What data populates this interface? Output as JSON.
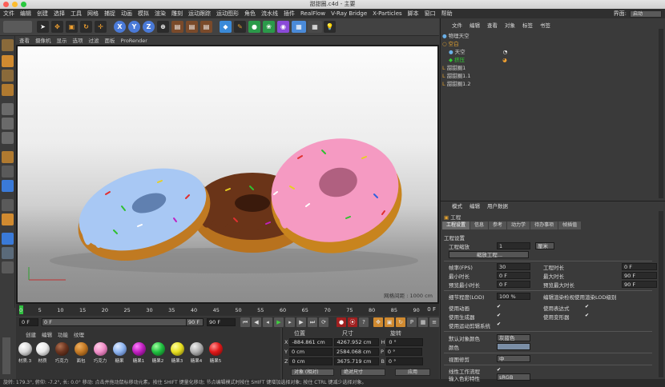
{
  "window": {
    "title": "甜甜圈.c4d - 主要"
  },
  "menubar": {
    "items": [
      "文件",
      "编辑",
      "创建",
      "选择",
      "工具",
      "网格",
      "捕捉",
      "动画",
      "模拟",
      "渲染",
      "雕刻",
      "运动跟踪",
      "运动图形",
      "角色",
      "流水线",
      "插件",
      "RealFlow",
      "V-Ray Bridge",
      "X-Particles",
      "脚本",
      "窗口",
      "帮助"
    ],
    "layout_label": "界面:",
    "layout_value": "启动"
  },
  "toolbar": {
    "axis_x": "X",
    "axis_y": "Y",
    "axis_z": "Z"
  },
  "viewport": {
    "menu": [
      "查看",
      "摄像机",
      "显示",
      "选项",
      "过滤",
      "面板",
      "ProRender"
    ],
    "grid_label": "网格间距 : 1000 cm"
  },
  "timeline": {
    "ticks": [
      "0",
      "5",
      "10",
      "15",
      "20",
      "25",
      "30",
      "35",
      "40",
      "45",
      "50",
      "55",
      "60",
      "65",
      "70",
      "75",
      "80",
      "85",
      "90"
    ],
    "frame_end_label": "0 F",
    "current_frame": "0 F",
    "start_frame": "0 F",
    "end_frame": "90 F",
    "max_frame": "90 F"
  },
  "materials": {
    "menu": [
      "创建",
      "编辑",
      "功能",
      "纹理"
    ],
    "items": [
      {
        "label": "材质.3",
        "color": "#d8d8d8"
      },
      {
        "label": "材质",
        "color": "#e9e9e9"
      },
      {
        "label": "巧克力",
        "color": "#6b3520"
      },
      {
        "label": "面包",
        "color": "#c47a25"
      },
      {
        "label": "巧克力",
        "color": "#f08fc8"
      },
      {
        "label": "糖果",
        "color": "#8fb5f0"
      },
      {
        "label": "糖果1",
        "color": "#c020c0"
      },
      {
        "label": "糖果2",
        "color": "#20c040"
      },
      {
        "label": "糖果3",
        "color": "#e8e020"
      },
      {
        "label": "糖果4",
        "color": "#b0b0b0"
      },
      {
        "label": "糖果5",
        "color": "#e01818"
      }
    ]
  },
  "coords": {
    "headers": [
      "位置",
      "尺寸",
      "旋转"
    ],
    "rows": [
      {
        "axis": "X",
        "pos": "-884.861 cm",
        "size": "4267.952 cm",
        "rot_axis": "H",
        "rot": "0 °"
      },
      {
        "axis": "Y",
        "pos": "0 cm",
        "size": "2584.068 cm",
        "rot_axis": "P",
        "rot": "0 °"
      },
      {
        "axis": "Z",
        "pos": "0 cm",
        "size": "3675.719 cm",
        "rot_axis": "B",
        "rot": "0 °"
      }
    ],
    "mode": "对象 (相对)",
    "size_mode": "绝对尺寸",
    "apply": "应用"
  },
  "objects": {
    "menu": [
      "文件",
      "编辑",
      "查看",
      "对象",
      "标签",
      "书签"
    ],
    "items": [
      {
        "name": "物理天空",
        "indent": 0,
        "color": "#cfcfcf"
      },
      {
        "name": "空白",
        "indent": 0,
        "color": "#e0a030"
      },
      {
        "name": "天空",
        "indent": 1,
        "color": "#cfcfcf"
      },
      {
        "name": "挤压",
        "indent": 1,
        "color": "#30d030"
      },
      {
        "name": "甜甜圈1",
        "indent": 0,
        "color": "#cfcfcf"
      },
      {
        "name": "甜甜圈1.1",
        "indent": 0,
        "color": "#cfcfcf"
      },
      {
        "name": "甜甜圈1.2",
        "indent": 0,
        "color": "#cfcfcf"
      }
    ]
  },
  "attributes": {
    "menu": [
      "模式",
      "编辑",
      "用户数据"
    ],
    "title": "工程",
    "tabs": [
      "工程设置",
      "信息",
      "参考",
      "动力学",
      "待办事项",
      "帧插值"
    ],
    "section": "工程设置",
    "scale_label": "工程缩放",
    "scale_value": "1",
    "scale_unit": "厘米",
    "scale_button": "缩放工程...",
    "fps_label": "帧率(FPS)",
    "fps_value": "30",
    "project_time_label": "工程时长",
    "project_time_value": "0 F",
    "min_time_label": "最小时长",
    "min_time_value": "0 F",
    "max_time_label": "最大时长",
    "max_time_value": "90 F",
    "preview_min_label": "预览最小时长",
    "preview_min_value": "0 F",
    "preview_max_label": "预览最大时长",
    "preview_max_value": "90 F",
    "lod_label": "细节程度(LOD)",
    "lod_value": "100 %",
    "lod_render_label": "编辑渲染检视使用渲染LOD级别",
    "use_anim_label": "使用动画",
    "use_expr_label": "使用表达式",
    "use_gen_label": "使用生成器",
    "use_deform_label": "使用变形器",
    "use_mograph_label": "使用运动剪辑系统",
    "default_color_label": "默认对象颜色",
    "default_color_value": "灰蓝色",
    "color_label": "颜色",
    "view_clip_label": "视图修剪",
    "view_clip_value": "中",
    "linear_label": "线性工作流程",
    "input_color_label": "输入色彩特性",
    "input_color_value": "sRGB"
  },
  "status": {
    "text": "旋转: 179.3°, 俯仰: -7.2°, 长: 0.0°  移动: 点击并拖动鼠标移动元素。按住 SHIFT 键量化移动; 节点编辑模式时按住 SHIFT 键增加选择对象; 按住 CTRL 键减少选择对象。"
  }
}
